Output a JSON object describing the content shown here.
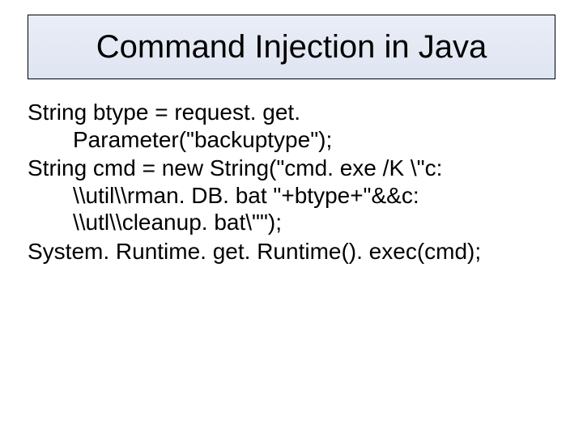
{
  "slide": {
    "title": "Command Injection in Java",
    "code_lines": {
      "line1": "String btype = request. get. Parameter(\"backuptype\");",
      "line2": "String cmd = new String(\"cmd. exe /K \\\"c: \\\\util\\\\rman. DB. bat \"+btype+\"&&c: \\\\utl\\\\cleanup. bat\\\"\");",
      "line3": "System. Runtime. get. Runtime(). exec(cmd);"
    }
  }
}
